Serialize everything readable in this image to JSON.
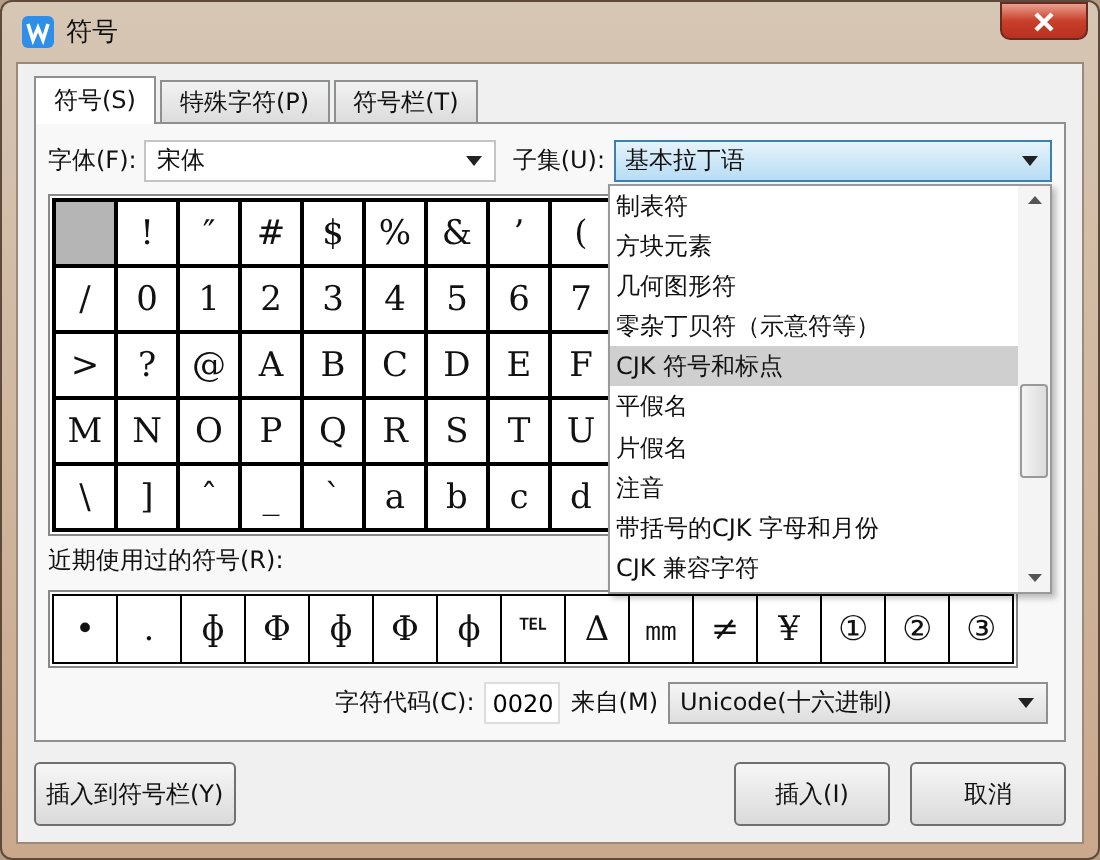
{
  "window": {
    "title": "符号"
  },
  "tabs": [
    {
      "label": "符号(S)",
      "selected": true
    },
    {
      "label": "特殊字符(P)",
      "selected": false
    },
    {
      "label": "符号栏(T)",
      "selected": false
    }
  ],
  "font": {
    "label": "字体(F):",
    "value": "宋体"
  },
  "subset": {
    "label": "子集(U):",
    "value": "基本拉丁语",
    "expanded": true
  },
  "subset_options": [
    {
      "label": "制表符",
      "selected": false
    },
    {
      "label": "方块元素",
      "selected": false
    },
    {
      "label": "几何图形符",
      "selected": false
    },
    {
      "label": "零杂丁贝符（示意符等）",
      "selected": false
    },
    {
      "label": "CJK 符号和标点",
      "selected": true
    },
    {
      "label": "平假名",
      "selected": false
    },
    {
      "label": "片假名",
      "selected": false
    },
    {
      "label": "注音",
      "selected": false
    },
    {
      "label": "带括号的CJK 字母和月份",
      "selected": false
    },
    {
      "label": "CJK 兼容字符",
      "selected": false
    }
  ],
  "symbol_grid": [
    [
      {
        "selected": true
      },
      {
        "char": "!",
        "selected": false
      },
      {
        "char": "″",
        "selected": false
      },
      {
        "char": "#",
        "selected": false
      },
      {
        "char": "$",
        "selected": false
      },
      {
        "char": "%",
        "selected": false
      },
      {
        "char": "&",
        "selected": false
      },
      {
        "char": "’",
        "selected": false
      },
      {
        "char": "(",
        "selected": false
      }
    ],
    [
      {
        "char": "/",
        "selected": false
      },
      {
        "char": "0",
        "selected": false
      },
      {
        "char": "1",
        "selected": false
      },
      {
        "char": "2",
        "selected": false
      },
      {
        "char": "3",
        "selected": false
      },
      {
        "char": "4",
        "selected": false
      },
      {
        "char": "5",
        "selected": false
      },
      {
        "char": "6",
        "selected": false
      },
      {
        "char": "7",
        "selected": false
      }
    ],
    [
      {
        "char": ">",
        "selected": false
      },
      {
        "char": "?",
        "selected": false
      },
      {
        "char": "@",
        "selected": false
      },
      {
        "char": "A",
        "selected": false
      },
      {
        "char": "B",
        "selected": false
      },
      {
        "char": "C",
        "selected": false
      },
      {
        "char": "D",
        "selected": false
      },
      {
        "char": "E",
        "selected": false
      },
      {
        "char": "F",
        "selected": false
      }
    ],
    [
      {
        "char": "M",
        "selected": false
      },
      {
        "char": "N",
        "selected": false
      },
      {
        "char": "O",
        "selected": false
      },
      {
        "char": "P",
        "selected": false
      },
      {
        "char": "Q",
        "selected": false
      },
      {
        "char": "R",
        "selected": false
      },
      {
        "char": "S",
        "selected": false
      },
      {
        "char": "T",
        "selected": false
      },
      {
        "char": "U",
        "selected": false
      }
    ],
    [
      {
        "char": "\\",
        "selected": false
      },
      {
        "char": "]",
        "selected": false
      },
      {
        "char": "ˆ",
        "selected": false
      },
      {
        "char": "_",
        "selected": false
      },
      {
        "char": "`",
        "selected": false
      },
      {
        "char": "a",
        "selected": false
      },
      {
        "char": "b",
        "selected": false
      },
      {
        "char": "c",
        "selected": false
      },
      {
        "char": "d",
        "selected": false
      }
    ]
  ],
  "recent": {
    "label": "近期使用过的符号(R):",
    "symbols": [
      "•",
      ".",
      "ɸ",
      "Φ",
      "ɸ",
      "Φ",
      "ϕ",
      "℡",
      "Δ",
      "㎜",
      "≠",
      "¥",
      "①",
      "②",
      "③"
    ]
  },
  "char_code": {
    "label": "字符代码(C):",
    "value": "0020"
  },
  "source": {
    "label": "来自(M)",
    "value": "Unicode(十六进制)"
  },
  "buttons": [
    {
      "label": "插入到符号栏(Y)",
      "kind": "left"
    },
    {
      "label": "插入(I)",
      "kind": "right"
    },
    {
      "label": "取消",
      "kind": "right"
    }
  ]
}
